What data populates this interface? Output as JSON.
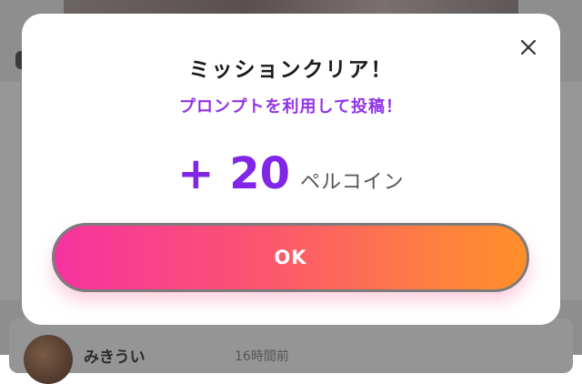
{
  "modal": {
    "title": "ミッションクリア！",
    "subtitle": "プロンプトを利用して投稿！",
    "reward_amount": "+ 20",
    "reward_unit": "ペルコイン",
    "ok_label": "OK",
    "close_icon": "close-icon"
  },
  "background": {
    "username": "みきうい",
    "time": "16時間前"
  },
  "colors": {
    "accent_purple": "#8125e6",
    "subtitle_purple": "#9233e6",
    "button_gradient_start": "#f7329f",
    "button_gradient_end": "#ff8f2a"
  }
}
